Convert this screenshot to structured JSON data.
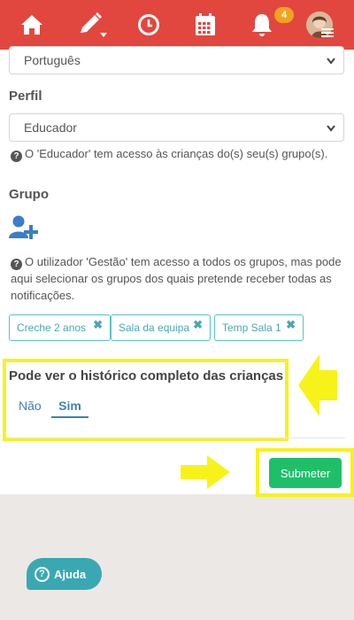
{
  "topbar": {
    "icons": [
      "home-icon",
      "edit-icon",
      "clock-icon",
      "calendar-icon",
      "bell-icon"
    ],
    "notifications_count": "4",
    "color": "#e2473f"
  },
  "form": {
    "language_select": {
      "value": "Português"
    },
    "perfil": {
      "label": "Perfil",
      "value": "Educador",
      "help": "O 'Educador' tem acesso às crianças do(s) seu(s) grupo(s)."
    },
    "grupo": {
      "label": "Grupo",
      "help_line1": "O utilizador 'Gestão' tem acesso a todos os grupos, mas pode",
      "help_line2": "aqui selecionar os grupos dos quais pretende receber todas as",
      "help_line3": "notificações.",
      "chips": [
        "Creche 2 anos",
        "Sala da equipa",
        "Temp Sala 1"
      ]
    },
    "history": {
      "label": "Pode ver o histórico completo das crianças",
      "options": [
        "Não",
        "Sim"
      ],
      "selected": "Sim"
    },
    "submit_label": "Submeter"
  },
  "help_button_label": "Ajuda",
  "colors": {
    "accent": "#3aa8b2",
    "submit": "#1fbf6a",
    "highlight": "#f7f31a"
  }
}
